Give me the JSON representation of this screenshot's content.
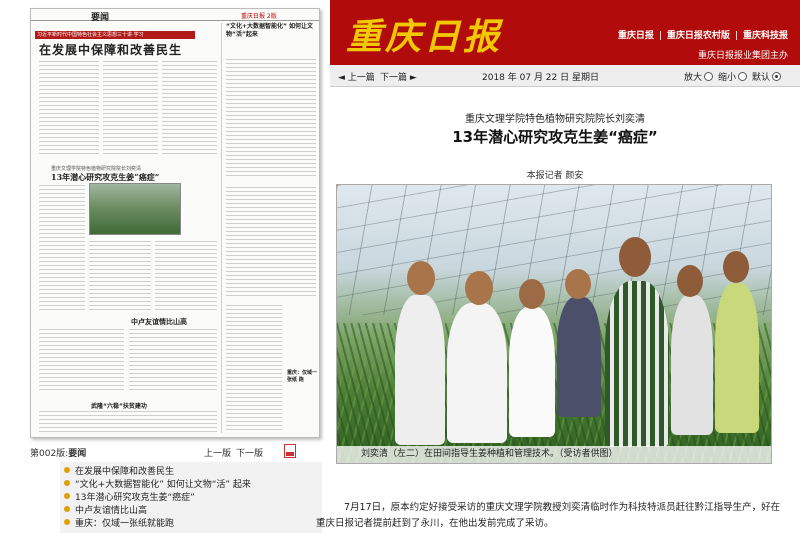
{
  "banner": {
    "logo": "重庆日报",
    "links": [
      "重庆日报",
      "重庆日报农村版",
      "重庆科技报"
    ],
    "publisher": "重庆日报报业集团主办"
  },
  "nav": {
    "prev": "上一篇",
    "next": "下一篇",
    "date": "2018 年 07 月 22 日   星期日",
    "zoom_in": "放大",
    "zoom_out": "缩小",
    "default": "默认"
  },
  "thumbnail": {
    "masthead_left": "要闻",
    "masthead_right": "重庆日报 2版",
    "red_bar": "习近平新时代中国特色社会主义思想三十讲·学习",
    "headline_main": "在发展中保障和改善民生",
    "headline_side": "“文化+大数据智能化” 如何让文物“活”起来",
    "headline_article_kicker": "重庆文理学院特色植物研究院院长刘奕清",
    "headline_article": "13年潜心研究攻克生姜“癌症”",
    "headline_lower": "中卢友谊情比山高",
    "headline_bottom": "武隆“六稳”扶贫建功",
    "headline_right": "重庆：仅域一张纸 跑"
  },
  "pagebar": {
    "page_prefix": "第002版:",
    "page_name": "要闻",
    "prev_page": "上一版",
    "next_page": "下一版"
  },
  "toc": [
    "在发展中保障和改善民生",
    "“文化+大数据智能化” 如何让文物“活” 起来",
    "13年潜心研究攻克生姜“癌症”",
    "中卢友谊情比山高",
    "重庆：仅域一张纸就能跑"
  ],
  "article": {
    "kicker": "重庆文理学院特色植物研究院院长刘奕清",
    "title": "13年潜心研究攻克生姜“癌症”",
    "byline": "本报记者  颜安",
    "photo_caption": "刘奕清（左二）在田间指导生姜种植和管理技术。（受访者供图）",
    "body": [
      "7月17日，原本约定好接受采访的重庆文理学院教授刘奕清临时作为科技特派员赶往黔江指导生产，好在重庆日报记者提前赶到了永川，在他出发前完成了采访。"
    ]
  },
  "colors": {
    "banner_red": "#b10b0b",
    "logo_gold": "#f2c900",
    "toc_bullet": "#e0a000"
  }
}
